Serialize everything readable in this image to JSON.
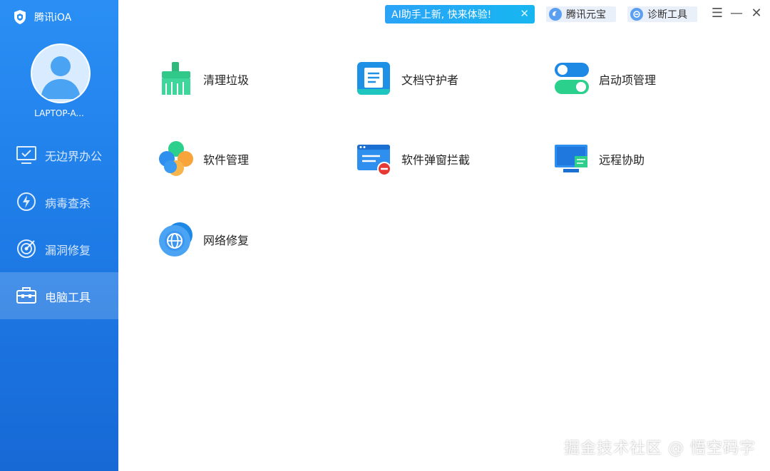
{
  "app": {
    "name": "腾讯iOA"
  },
  "user": {
    "device": "LAPTOP-A..."
  },
  "sidebar": {
    "items": [
      {
        "label": "无边界办公",
        "icon": "monitor-check-icon"
      },
      {
        "label": "病毒查杀",
        "icon": "lightning-shield-icon"
      },
      {
        "label": "漏洞修复",
        "icon": "target-icon"
      },
      {
        "label": "电脑工具",
        "icon": "toolbox-icon",
        "active": true
      }
    ]
  },
  "topbar": {
    "ai_banner": "AI助手上新, 快来体验!",
    "ai_close": "✕",
    "yuanbao": "腾讯元宝",
    "diagnose": "诊断工具",
    "menu": "☰",
    "minimize": "—",
    "close": "✕"
  },
  "tools": [
    {
      "label": "清理垃圾",
      "icon": "broom-icon"
    },
    {
      "label": "文档守护者",
      "icon": "document-icon"
    },
    {
      "label": "启动项管理",
      "icon": "toggle-switch-icon"
    },
    {
      "label": "软件管理",
      "icon": "clover-apps-icon"
    },
    {
      "label": "软件弹窗拦截",
      "icon": "popup-block-icon"
    },
    {
      "label": "远程协助",
      "icon": "remote-monitor-icon"
    },
    {
      "label": "网络修复",
      "icon": "globe-repair-icon"
    }
  ],
  "watermark": "掘金技术社区 @ 悟空码字",
  "colors": {
    "sidebar": "#1f7de8",
    "accent": "#2aa3f7",
    "green": "#2ccf8f",
    "orange": "#f7a53a"
  }
}
